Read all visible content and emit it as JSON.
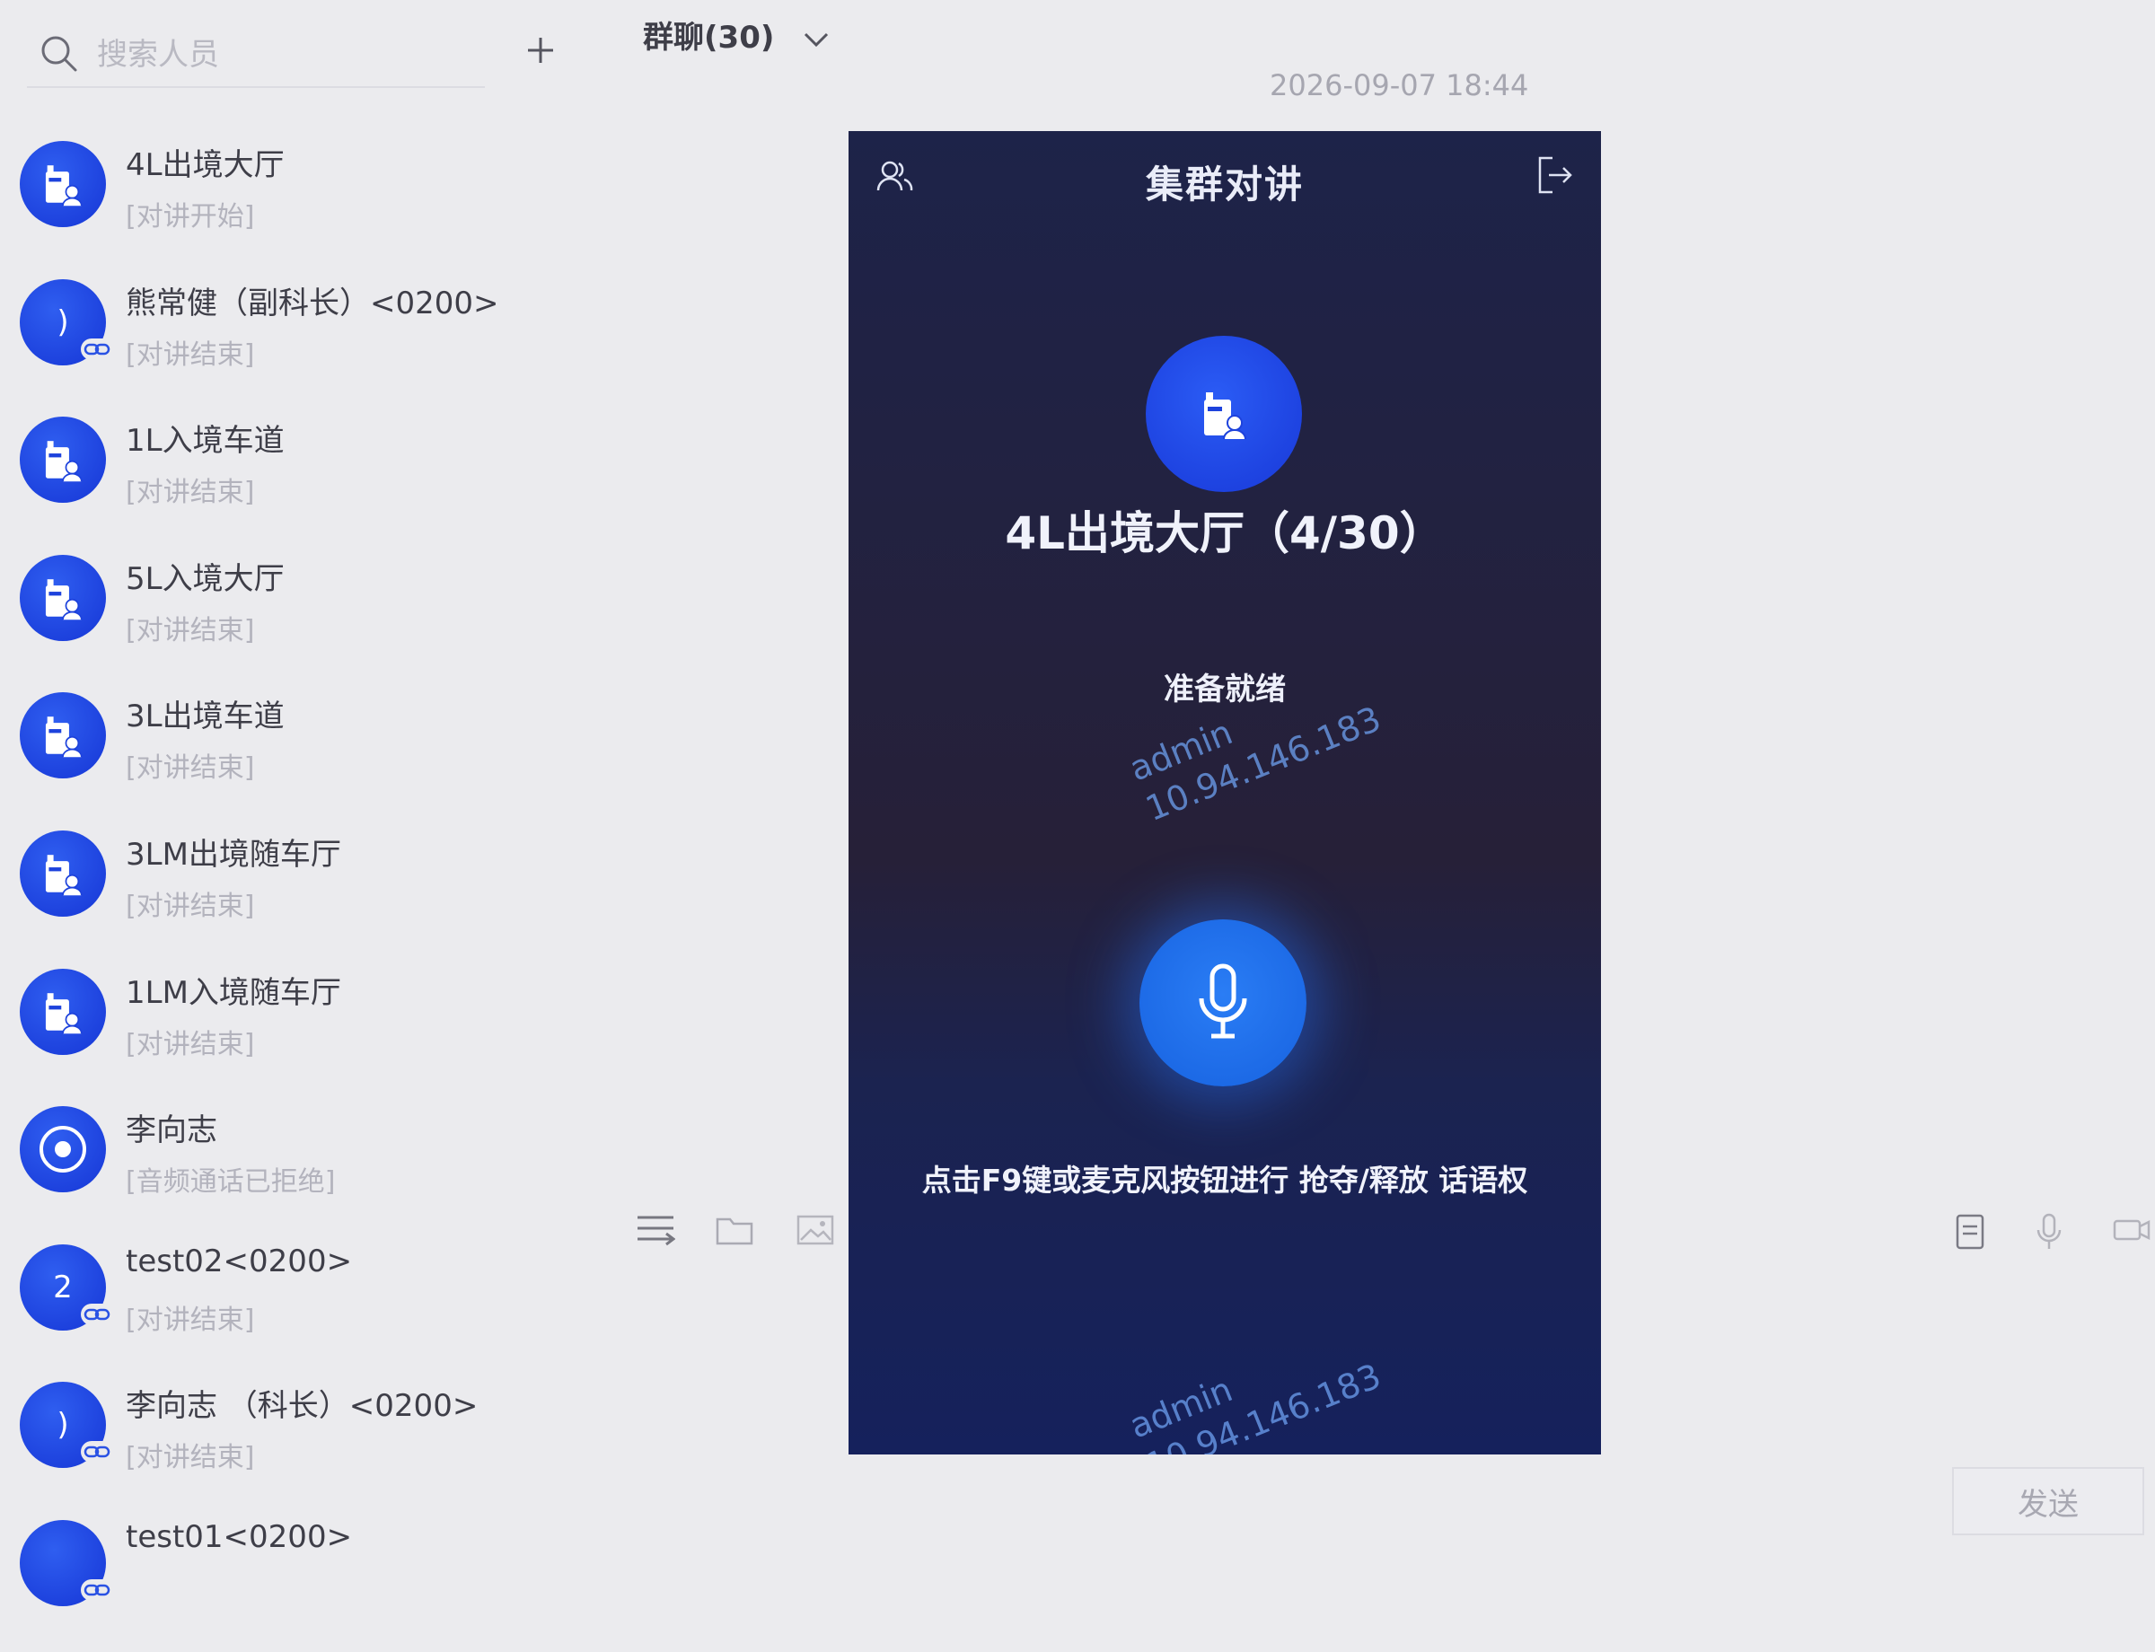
{
  "search": {
    "placeholder": "搜索人员"
  },
  "chat": {
    "title": "群聊(30)",
    "timestamp": "2026-09-07 18:44"
  },
  "contacts": [
    {
      "name": "4L出境大厅",
      "status": "[对讲开始]",
      "type": "group"
    },
    {
      "name": "熊常健（副科长）<0200>",
      "status": "[对讲结束]",
      "type": "person",
      "initial": ")"
    },
    {
      "name": "1L入境车道",
      "status": "[对讲结束]",
      "type": "group"
    },
    {
      "name": "5L入境大厅",
      "status": "[对讲结束]",
      "type": "group"
    },
    {
      "name": "3L出境车道",
      "status": "[对讲结束]",
      "type": "group"
    },
    {
      "name": "3LM出境随车厅",
      "status": "[对讲结束]",
      "type": "group"
    },
    {
      "name": "1LM入境随车厅",
      "status": "[对讲结束]",
      "type": "group"
    },
    {
      "name": "李向志",
      "status": "[音频通话已拒绝]",
      "type": "camera"
    },
    {
      "name": "test02<0200>",
      "status": "[对讲结束]",
      "type": "person",
      "initial": "2"
    },
    {
      "name": "李向志 （科长）<0200>",
      "status": "[对讲结束]",
      "type": "person",
      "initial": ")"
    },
    {
      "name": "test01<0200>",
      "status": "",
      "type": "person",
      "initial": ""
    }
  ],
  "toolbar": {
    "send_label": "发送"
  },
  "intercom": {
    "title": "集群对讲",
    "group_name": "4L出境大厅（4/30）",
    "status": "准备就绪",
    "hint": "点击F9键或麦克风按钮进行 抢夺/释放 话语权",
    "watermark": {
      "user": "admin",
      "ip": "10.94.146.183"
    }
  },
  "colors": {
    "accent": "#1f47e6",
    "modal_bg": "#20223f",
    "mic": "#1f6ff0"
  }
}
